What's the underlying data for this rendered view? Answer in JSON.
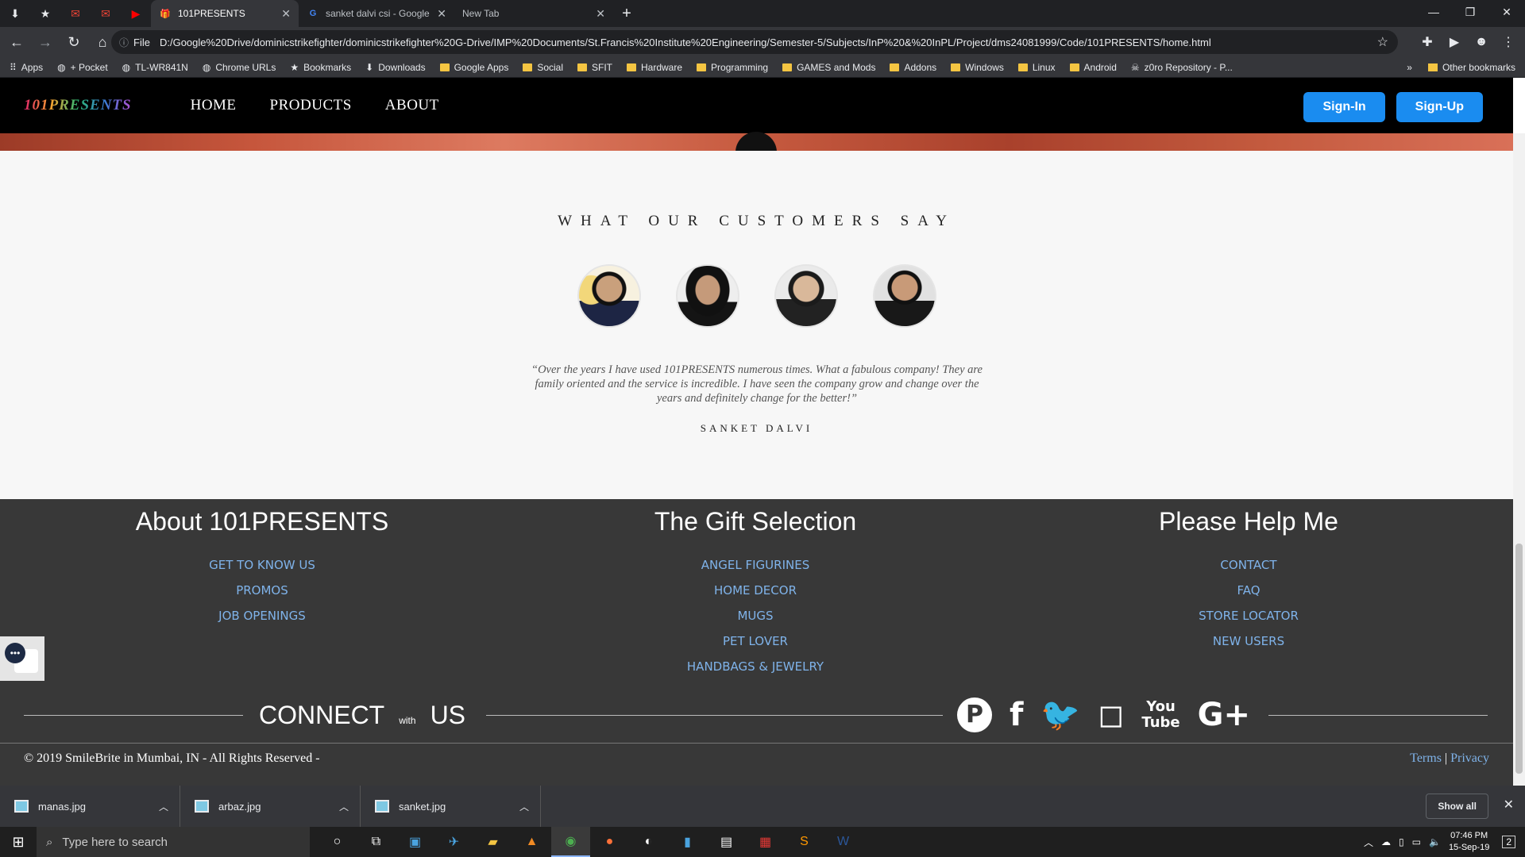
{
  "browser": {
    "tabs": [
      {
        "title": "101PRESENTS",
        "active": true
      },
      {
        "title": "sanket dalvi csi - Google Search",
        "active": false
      },
      {
        "title": "New Tab",
        "active": false
      }
    ],
    "omnibox": {
      "scheme": "File",
      "url": "D:/Google%20Drive/dominicstrikefighter/dominicstrikefighter%20G-Drive/IMP%20Documents/St.Francis%20Institute%20Engineering/Semester-5/Subjects/InP%20&%20InPL/Project/dms24081999/Code/101PRESENTS/home.html"
    },
    "bookmarks": [
      {
        "label": "Apps",
        "icon": "apps-grid-icon"
      },
      {
        "label": "+ Pocket",
        "icon": "globe-icon"
      },
      {
        "label": "TL-WR841N",
        "icon": "globe-icon"
      },
      {
        "label": "Chrome URLs",
        "icon": "globe-icon"
      },
      {
        "label": "Bookmarks",
        "icon": "star-icon"
      },
      {
        "label": "Downloads",
        "icon": "download-icon"
      },
      {
        "label": "Google Apps",
        "icon": "folder-icon"
      },
      {
        "label": "Social",
        "icon": "folder-icon"
      },
      {
        "label": "SFIT",
        "icon": "folder-icon"
      },
      {
        "label": "Hardware",
        "icon": "folder-icon"
      },
      {
        "label": "Programming",
        "icon": "folder-icon"
      },
      {
        "label": "GAMES and Mods",
        "icon": "folder-icon"
      },
      {
        "label": "Addons",
        "icon": "folder-icon"
      },
      {
        "label": "Windows",
        "icon": "folder-icon"
      },
      {
        "label": "Linux",
        "icon": "folder-icon"
      },
      {
        "label": "Android",
        "icon": "folder-icon"
      },
      {
        "label": "z0ro Repository - P...",
        "icon": "skull-icon"
      }
    ],
    "other_bookmarks": "Other bookmarks",
    "overflow": "»"
  },
  "site": {
    "logo": "101PRESENTS",
    "nav": [
      "HOME",
      "PRODUCTS",
      "ABOUT"
    ],
    "signin": "Sign-In",
    "signup": "Sign-Up",
    "testimonials": {
      "heading": "WHAT OUR CUSTOMERS SAY",
      "quote": "“Over the years I have used 101PRESENTS numerous times. What a fabulous company! They are family oriented and the service is incredible. I have seen the company grow and change over the years and definitely change for the better!”",
      "author": "SANKET DALVI"
    },
    "footer": {
      "columns": [
        {
          "title": "About 101PRESENTS",
          "links": [
            "GET TO KNOW US",
            "PROMOS",
            "JOB OPENINGS"
          ]
        },
        {
          "title": "The Gift Selection",
          "links": [
            "ANGEL FIGURINES",
            "HOME DECOR",
            "MUGS",
            "PET LOVER",
            "HANDBAGS & JEWELRY"
          ]
        },
        {
          "title": "Please Help Me",
          "links": [
            "CONTACT",
            "FAQ",
            "STORE LOCATOR",
            "NEW USERS"
          ]
        }
      ],
      "connect": {
        "word1": "CONNECT",
        "with": "with",
        "word2": "US"
      },
      "social_icons": [
        "pinterest-icon",
        "facebook-icon",
        "twitter-icon",
        "instagram-icon",
        "youtube-icon",
        "google-plus-icon"
      ],
      "copyright": "© 2019 SmileBrite in Mumbai, IN - All Rights Reserved -",
      "terms": "Terms",
      "separator": "|",
      "privacy": "Privacy"
    }
  },
  "downloads": {
    "items": [
      "manas.jpg",
      "arbaz.jpg",
      "sanket.jpg"
    ],
    "show_all": "Show all"
  },
  "taskbar": {
    "search_placeholder": "Type here to search",
    "time": "07:46 PM",
    "date": "15-Sep-19",
    "notifications": "2"
  }
}
